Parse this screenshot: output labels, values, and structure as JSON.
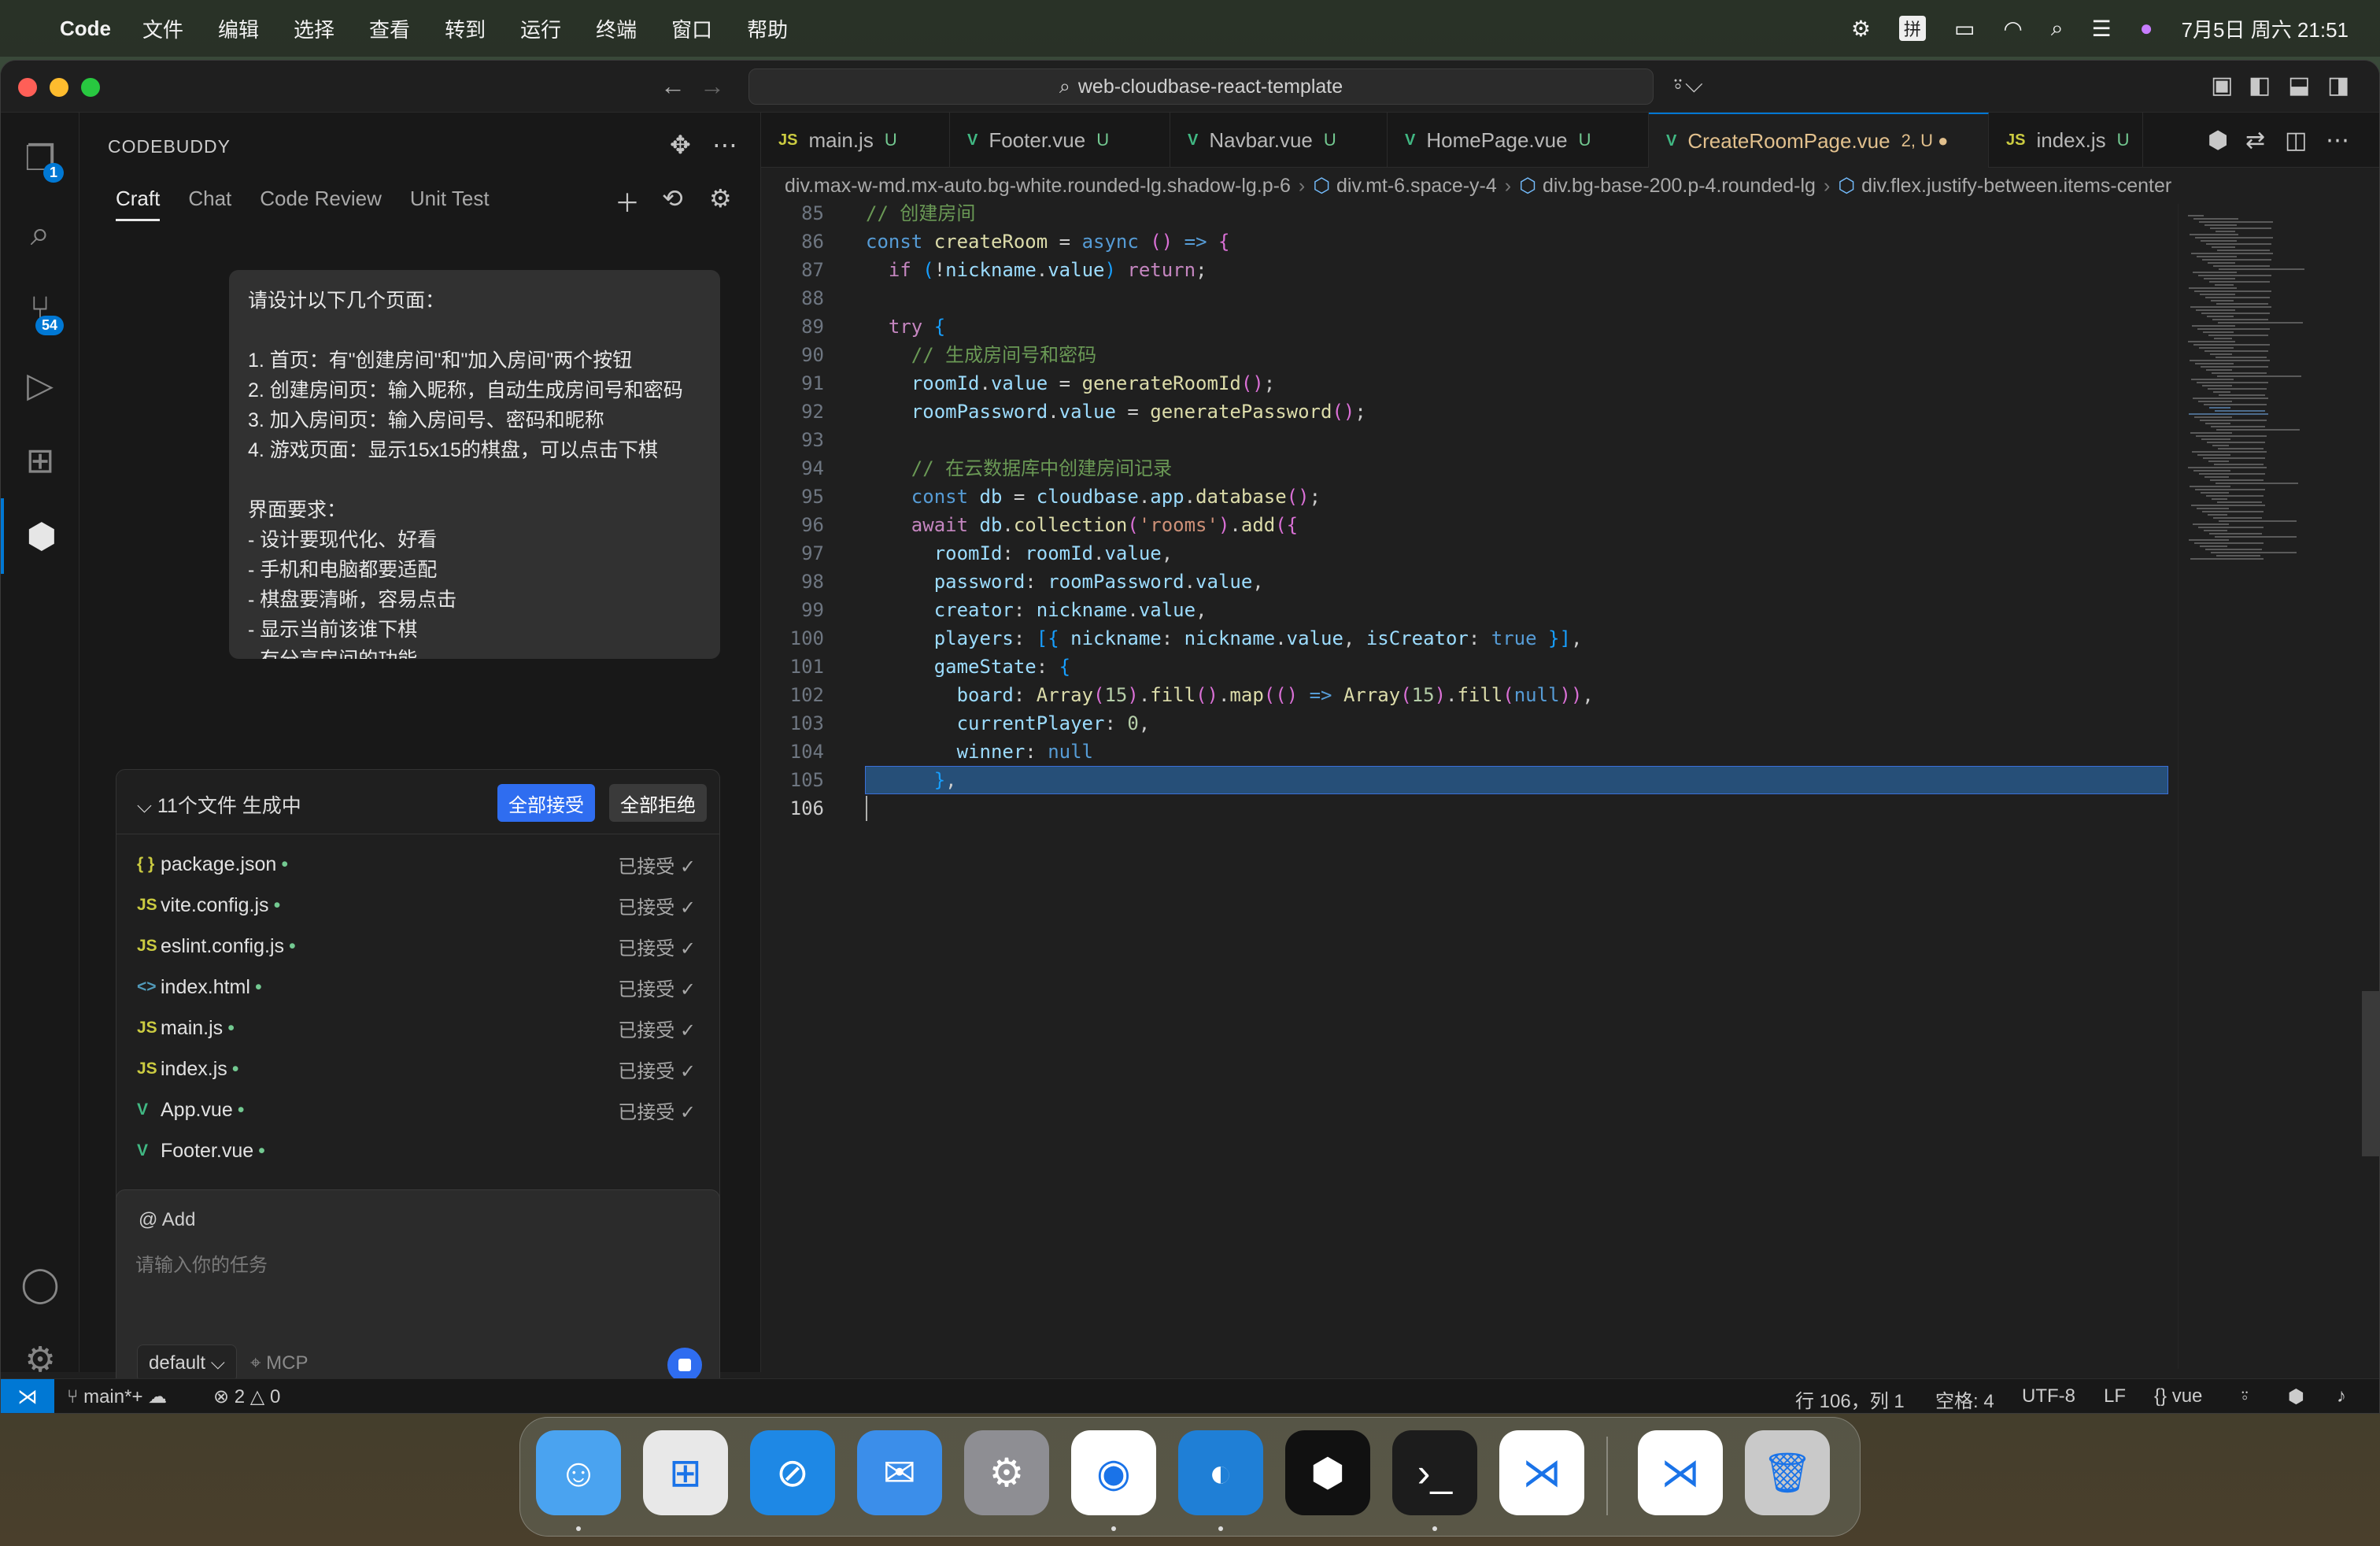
{
  "menubar": {
    "app_name": "Code",
    "items": [
      "文件",
      "编辑",
      "选择",
      "查看",
      "转到",
      "运行",
      "终端",
      "窗口",
      "帮助"
    ],
    "clock": "7月5日 周六  21:51",
    "input_method": "拼"
  },
  "titlebar": {
    "search_text": "web-cloudbase-react-template"
  },
  "activity_bar": {
    "explorer_badge": "1",
    "scm_badge": "54"
  },
  "sidebar": {
    "title": "CODEBUDDY",
    "tabs": [
      "Craft",
      "Chat",
      "Code Review",
      "Unit Test"
    ],
    "user_message": "请设计以下几个页面：\n\n1. 首页：有\"创建房间\"和\"加入房间\"两个按钮\n2. 创建房间页：输入昵称，自动生成房间号和密码\n3. 加入房间页：输入房间号、密码和昵称\n4. 游戏页面：显示15x15的棋盘，可以点击下棋\n\n界面要求：\n- 设计要现代化、好看\n- 手机和电脑都要适配\n- 棋盘要清晰，容易点击\n- 显示当前该谁下棋\n- 有分享房间的功能",
    "files_panel": {
      "title": "11个文件 生成中",
      "accept_all": "全部接受",
      "reject_all": "全部拒绝",
      "files": [
        {
          "icon": "{ }",
          "name": "package.json",
          "status": "已接受 ✓",
          "icon_color": "#cbcb41"
        },
        {
          "icon": "JS",
          "name": "vite.config.js",
          "status": "已接受 ✓",
          "icon_color": "#cbcb41"
        },
        {
          "icon": "JS",
          "name": "eslint.config.js",
          "status": "已接受 ✓",
          "icon_color": "#cbcb41"
        },
        {
          "icon": "<>",
          "name": "index.html",
          "status": "已接受 ✓",
          "icon_color": "#519aba"
        },
        {
          "icon": "JS",
          "name": "main.js",
          "status": "已接受 ✓",
          "icon_color": "#cbcb41"
        },
        {
          "icon": "JS",
          "name": "index.js",
          "status": "已接受 ✓",
          "icon_color": "#cbcb41"
        },
        {
          "icon": "V",
          "name": "App.vue",
          "status": "已接受 ✓",
          "icon_color": "#41b883"
        },
        {
          "icon": "V",
          "name": "Footer.vue",
          "status": "",
          "icon_color": "#41b883"
        }
      ]
    },
    "input": {
      "add_label": "@ Add",
      "placeholder": "请输入你的任务",
      "model": "default ⌵",
      "mcp": "⌖ MCP"
    }
  },
  "editor": {
    "tabs": [
      {
        "icon": "JS",
        "name": "main.js",
        "suffix": "U",
        "icon_color": "#cbcb41"
      },
      {
        "icon": "V",
        "name": "Footer.vue",
        "suffix": "U",
        "icon_color": "#41b883"
      },
      {
        "icon": "V",
        "name": "Navbar.vue",
        "suffix": "U",
        "icon_color": "#41b883"
      },
      {
        "icon": "V",
        "name": "HomePage.vue",
        "suffix": "U",
        "icon_color": "#41b883"
      },
      {
        "icon": "V",
        "name": "CreateRoomPage.vue",
        "suffix": "2, U  ●",
        "icon_color": "#41b883"
      },
      {
        "icon": "JS",
        "name": "index.js",
        "suffix": "U",
        "icon_color": "#cbcb41"
      }
    ],
    "breadcrumbs": [
      "div.max-w-md.mx-auto.bg-white.rounded-lg.shadow-lg.p-6",
      "div.mt-6.space-y-4",
      "div.bg-base-200.p-4.rounded-lg",
      "div.flex.justify-between.items-center"
    ],
    "line_numbers": [
      "85",
      "86",
      "87",
      "88",
      "89",
      "90",
      "91",
      "92",
      "93",
      "94",
      "95",
      "96",
      "97",
      "98",
      "99",
      "100",
      "101",
      "102",
      "103",
      "104",
      "105",
      "106"
    ],
    "active_line": "106"
  },
  "statusbar": {
    "branch": "main*+",
    "errors": "2",
    "warnings": "0",
    "position": "行 106，列 1",
    "spaces": "空格: 4",
    "encoding": "UTF-8",
    "eol": "LF",
    "language": "vue"
  },
  "dock": {
    "apps": [
      "finder-icon",
      "launchpad-icon",
      "safari-icon",
      "mail-icon",
      "system-settings-icon",
      "chrome-icon",
      "edge-icon",
      "codebuddy-icon",
      "terminal-icon",
      "vscode-icon",
      "vscode-downloads-icon",
      "trash-icon"
    ]
  }
}
